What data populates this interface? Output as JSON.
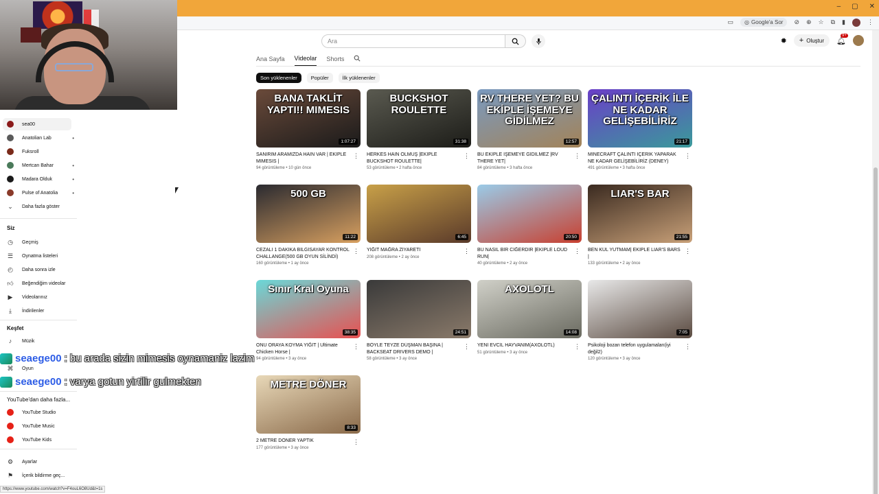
{
  "browser": {
    "google_chip": "Google'a Sor"
  },
  "header": {
    "search_placeholder": "Ara",
    "create_label": "Oluştur",
    "notif_count": "9+"
  },
  "tabs": [
    {
      "label": "Ana Sayfa",
      "active": false
    },
    {
      "label": "Videolar",
      "active": true
    },
    {
      "label": "Shorts",
      "active": false
    }
  ],
  "chips": [
    {
      "label": "Son yüklenenler",
      "active": true
    },
    {
      "label": "Popüler",
      "active": false
    },
    {
      "label": "İlk yüklenenler",
      "active": false
    }
  ],
  "videos": [
    {
      "title": "SANIRIM ARAMIZDA HAİN VAR | EKİPLE MIMESIS |",
      "meta": "94 görüntüleme • 10 gün önce",
      "duration": "1:07:27",
      "thumb_text": "BANA TAKLİT YAPTI!! MIMESIS",
      "colors": [
        "#6a4a3a",
        "#1a1a1a"
      ]
    },
    {
      "title": "HERKES HAİN OLMUŞ |EKİPLE BUCKSHOT ROULETTE|",
      "meta": "53 görüntüleme • 2 hafta önce",
      "duration": "31:38",
      "thumb_text": "BUCKSHOT ROULETTE",
      "colors": [
        "#5a5a50",
        "#1c1c18"
      ]
    },
    {
      "title": "BU EKİPLE İŞEMEYE GİDİLMEZ |RV THERE YET|",
      "meta": "84 görüntüleme • 3 hafta önce",
      "duration": "12:57",
      "thumb_text": "RV THERE YET? BU EKİPLE İŞEMEYE GİDİLMEZ",
      "colors": [
        "#7a9ac0",
        "#a38358"
      ]
    },
    {
      "title": "MINECRAFT ÇALINTI İÇERİK YAPARAK NE KADAR GELİŞEBİLİRİZ (DENEY)",
      "meta": "491 görüntüleme • 3 hafta önce",
      "duration": "21:17",
      "thumb_text": "ÇALINTI İÇERİK İLE NE KADAR GELİŞEBİLİRİZ",
      "colors": [
        "#6a3fc8",
        "#3a9a9a"
      ]
    },
    {
      "title": "CEZALI 1 DAKİKA BİLGİSAYAR KONTROL CHALLANGE(500 GB OYUN SİLİNDİ)",
      "meta": "160 görüntüleme • 1 ay önce",
      "duration": "11:22",
      "thumb_text": "500 GB",
      "colors": [
        "#2a2a30",
        "#d8a060"
      ]
    },
    {
      "title": "YİĞİT MAĞRA ZİYARETİ",
      "meta": "208 görüntüleme • 2 ay önce",
      "duration": "6:45",
      "thumb_text": "",
      "colors": [
        "#c8a048",
        "#5a3a2a"
      ]
    },
    {
      "title": "BU NASIL BİR CİĞERDİR |EKİPLE LOUD RUN|",
      "meta": "40 görüntüleme • 2 ay önce",
      "duration": "20:50",
      "thumb_text": "",
      "colors": [
        "#9acbe8",
        "#c84030"
      ]
    },
    {
      "title": "BEN KÜL YUTMAM| EKİPLE LIAR'S BARS |",
      "meta": "133 görüntüleme • 2 ay önce",
      "duration": "21:55",
      "thumb_text": "LIAR'S BAR",
      "colors": [
        "#3a2a20",
        "#c8a078"
      ]
    },
    {
      "title": "ONU ORAYA KOYMA YİĞİT | Ultimate Chicken Horse |",
      "meta": "94 görüntüleme • 3 ay önce",
      "duration": "38:35",
      "thumb_text": "Sınır Kral Oyuna",
      "colors": [
        "#6ad8d8",
        "#e85050"
      ]
    },
    {
      "title": "BÖYLE TEYZE DÜŞMAN BAŞINA | BACKSEAT DRIVERS DEMO |",
      "meta": "58 görüntüleme • 3 ay önce",
      "duration": "24:51",
      "thumb_text": "",
      "colors": [
        "#3a3a3a",
        "#8a7a6a"
      ]
    },
    {
      "title": "YENİ EVCİL HAYVANIM(AXOLOTL)",
      "meta": "51 görüntüleme • 3 ay önce",
      "duration": "14:08",
      "thumb_text": "AXOLOTL",
      "colors": [
        "#d0d0c8",
        "#6a6a60"
      ]
    },
    {
      "title": "Psikoloji bozan telefon uygulamaları(iyi değil2)",
      "meta": "120 görüntüleme • 3 ay önce",
      "duration": "7:05",
      "thumb_text": "",
      "colors": [
        "#e8e8e8",
        "#5a4a40"
      ]
    },
    {
      "title": "2 METRE DÖNER YAPTIK",
      "meta": "177 görüntüleme • 3 ay önce",
      "duration": "8:33",
      "thumb_text": "METRE DÖNER",
      "colors": [
        "#e8d8b8",
        "#8a6a4a"
      ]
    }
  ],
  "sidebar": {
    "subscriptions": [
      {
        "label": "sea00",
        "color": "#8a1a1a",
        "dot": false,
        "active": true
      },
      {
        "label": "Anatolian Lab",
        "color": "#5a5a5a",
        "dot": true
      },
      {
        "label": "Fuksroll",
        "color": "#7a2a1a",
        "dot": false
      },
      {
        "label": "Mertcan Bahar",
        "color": "#4a7a5a",
        "dot": true
      },
      {
        "label": "Madara Olduk",
        "color": "#1a1a1a",
        "dot": true
      },
      {
        "label": "Pulse of Anatolia",
        "color": "#8a3a2a",
        "dot": true
      }
    ],
    "show_more": "Daha fazla göster",
    "you_heading": "Siz",
    "you_items": [
      "Geçmiş",
      "Oynatma listeleri",
      "Daha sonra izle",
      "Beğendiğim videolar",
      "Videolarınız",
      "İndirilenler"
    ],
    "explore_heading": "Keşfet",
    "explore_items": [
      "Müzik",
      "Oyun"
    ],
    "more_heading": "YouTube'dan daha fazla...",
    "more_items": [
      "YouTube Studio",
      "YouTube Music",
      "YouTube Kids"
    ],
    "bottom_items": [
      "Ayarlar",
      "İçerik bildirme geç..."
    ]
  },
  "chat": [
    {
      "user": "seaege00",
      "message": ": bu arada sizin mimesis oynamaniz lazim"
    },
    {
      "user": "seaege00",
      "message": ": varya gotun yirtilir gulmekten"
    }
  ],
  "status_url": "https://www.youtube.com/watch?v=F4ouL6O8Ud&t=1s"
}
